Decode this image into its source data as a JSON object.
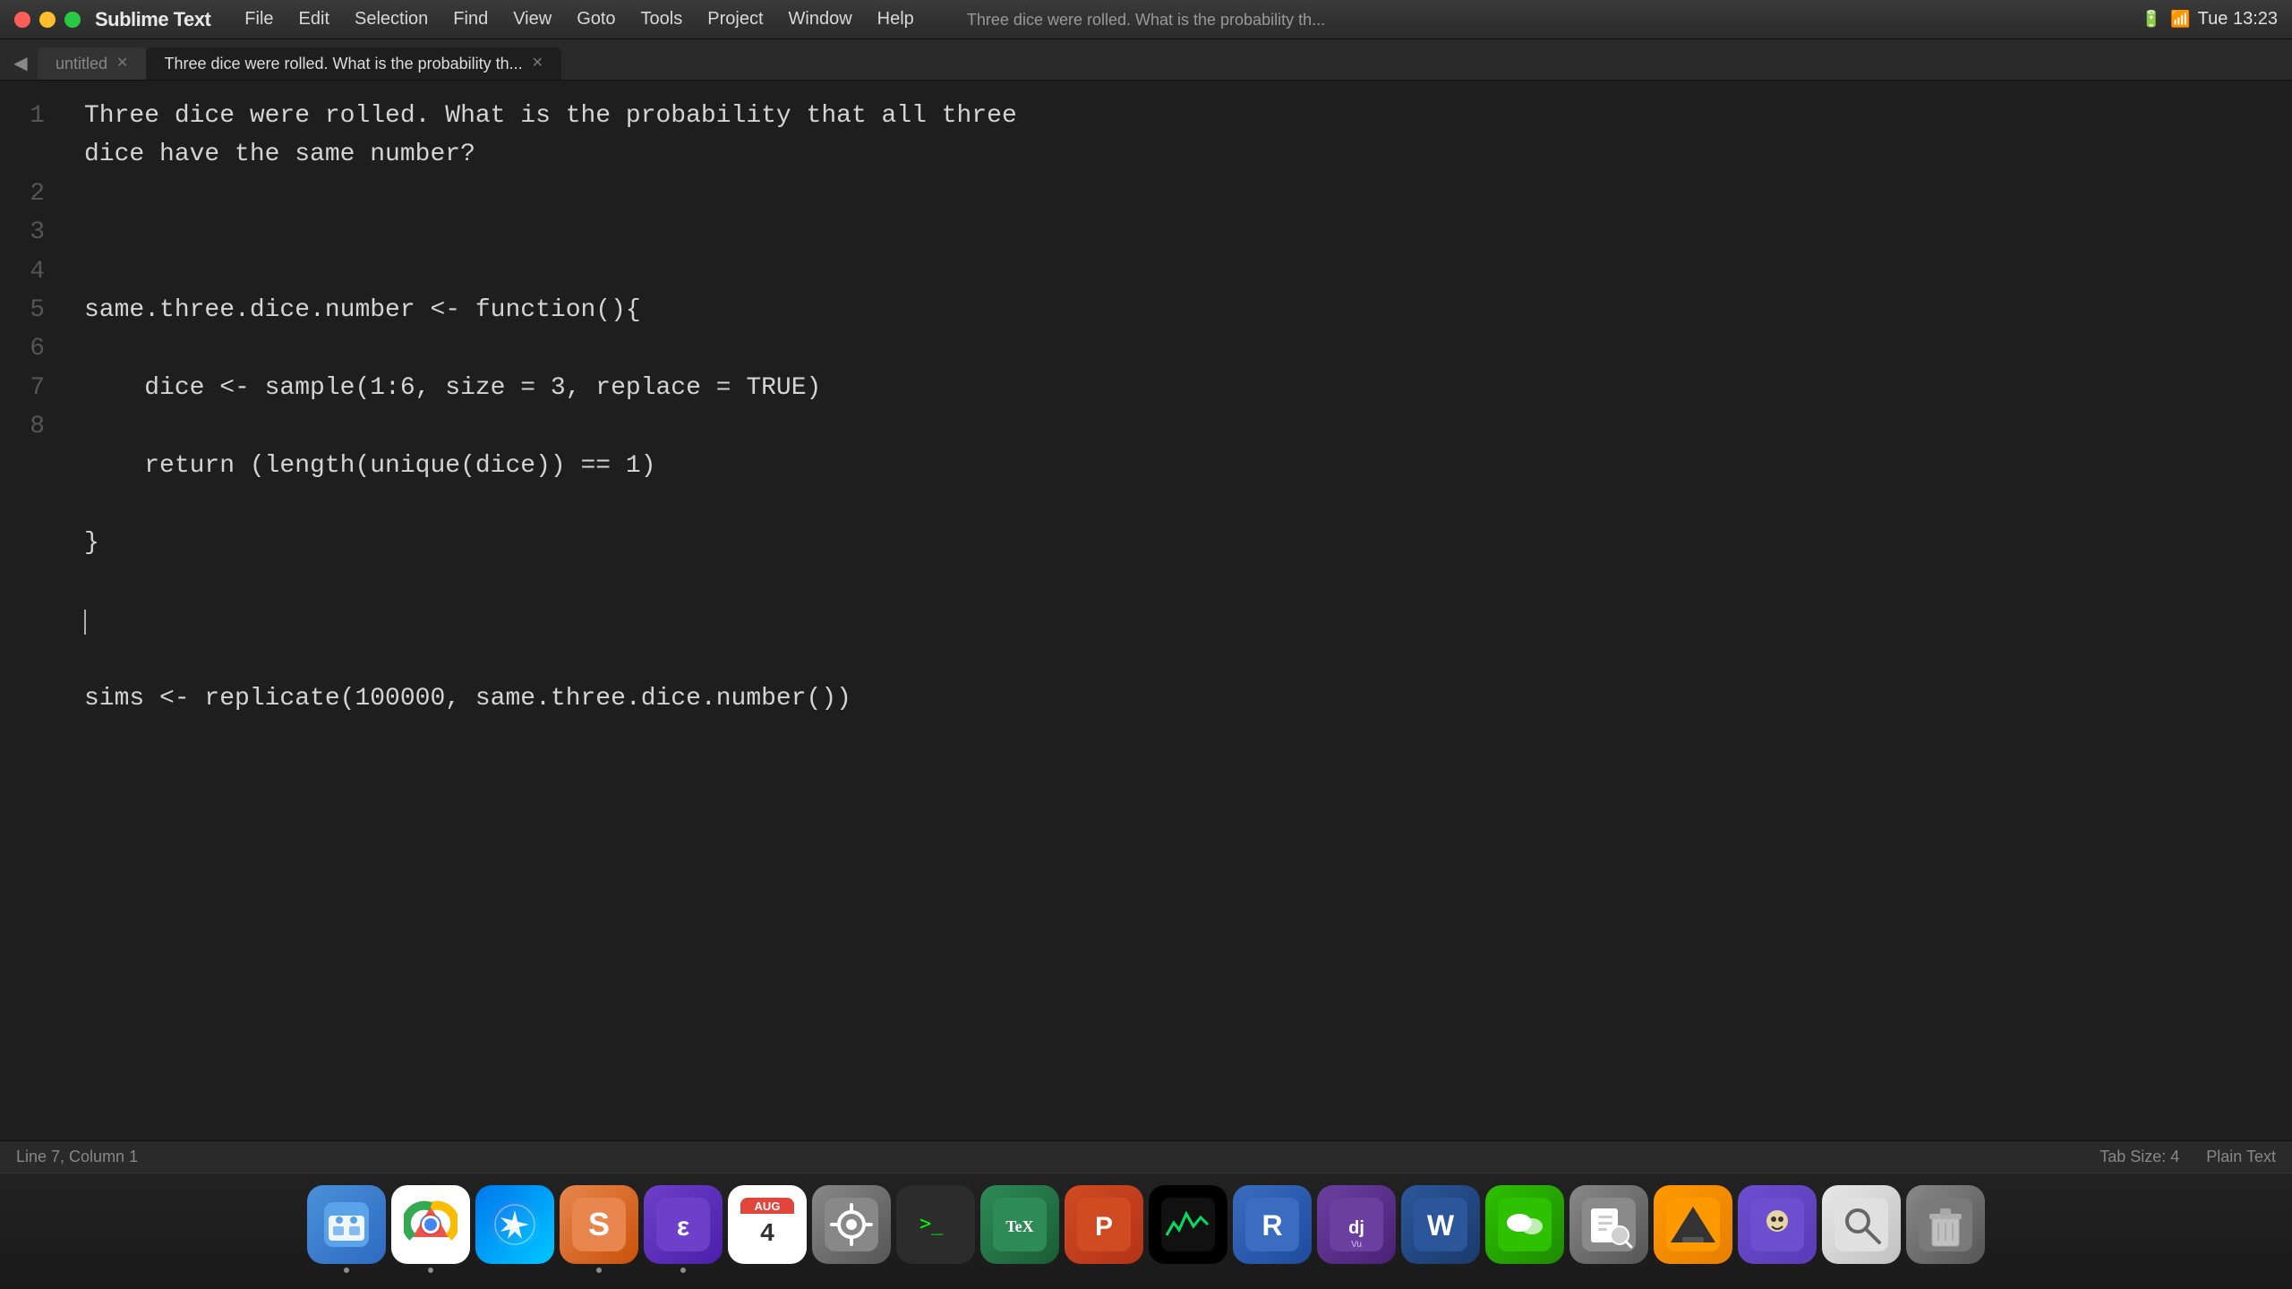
{
  "menubar": {
    "app_name": "Sublime Text",
    "items": [
      "File",
      "Edit",
      "Selection",
      "Find",
      "View",
      "Goto",
      "Tools",
      "Project",
      "Window",
      "Help"
    ],
    "clock": "Tue 13:23",
    "battery_icon": "🔋",
    "wifi_icon": "📶"
  },
  "tabbar": {
    "back_label": "◀",
    "tabs": [
      {
        "label": "untitled",
        "active": false
      },
      {
        "label": "Three dice were rolled. What is the probability th...",
        "active": true
      }
    ]
  },
  "title": "Three dice were rolled. What is the probability th...",
  "editor": {
    "lines": [
      {
        "number": "1",
        "code": "Three dice were rolled. What is the probability that all three"
      },
      {
        "number": "",
        "code": "dice have the same number?"
      },
      {
        "number": "2",
        "code": ""
      },
      {
        "number": "3",
        "code": "same.three.dice.number <- function(){"
      },
      {
        "number": "4",
        "code": "    dice <- sample(1:6, size = 3, replace = TRUE)"
      },
      {
        "number": "5",
        "code": "    return (length(unique(dice)) == 1)"
      },
      {
        "number": "6",
        "code": "}"
      },
      {
        "number": "7",
        "code": ""
      },
      {
        "number": "8",
        "code": "sims <- replicate(100000, same.three.dice.number())"
      }
    ]
  },
  "statusbar": {
    "position": "Line 7, Column 1",
    "tab_size": "Tab Size: 4",
    "file_type": "Plain Text"
  },
  "dock": {
    "items": [
      {
        "name": "Finder",
        "emoji": "🗂️",
        "colorClass": "finder-icon",
        "dot": true
      },
      {
        "name": "Chrome",
        "emoji": "🌐",
        "colorClass": "chrome-icon",
        "dot": true
      },
      {
        "name": "Safari",
        "emoji": "🧭",
        "colorClass": "safari-icon",
        "dot": false
      },
      {
        "name": "Sublime Text",
        "emoji": "✦",
        "colorClass": "sublime-icon",
        "dot": true
      },
      {
        "name": "Emacs",
        "emoji": "ε",
        "colorClass": "emacs-icon",
        "dot": true
      },
      {
        "name": "Calendar",
        "emoji": "📅",
        "colorClass": "calendar-icon",
        "dot": false
      },
      {
        "name": "System Preferences",
        "emoji": "⚙️",
        "colorClass": "system-icon",
        "dot": false
      },
      {
        "name": "Terminal",
        "emoji": ">_",
        "colorClass": "terminal-icon",
        "dot": false
      },
      {
        "name": "TeX",
        "emoji": "TeX",
        "colorClass": "tex-icon",
        "dot": false
      },
      {
        "name": "PowerPoint",
        "emoji": "P",
        "colorClass": "powerpoint-icon",
        "dot": false
      },
      {
        "name": "Activity Monitor",
        "emoji": "📊",
        "colorClass": "activity-icon",
        "dot": false
      },
      {
        "name": "R",
        "emoji": "R",
        "colorClass": "r-icon",
        "dot": false
      },
      {
        "name": "DjVu",
        "emoji": "dj",
        "colorClass": "djvu-icon",
        "dot": false
      },
      {
        "name": "Word",
        "emoji": "W",
        "colorClass": "word-icon",
        "dot": false
      },
      {
        "name": "WeChat",
        "emoji": "💬",
        "colorClass": "wechat-icon",
        "dot": false
      },
      {
        "name": "Preview",
        "emoji": "🖼️",
        "colorClass": "preview-icon",
        "dot": false
      },
      {
        "name": "VLC",
        "emoji": "🔶",
        "colorClass": "vlc-icon",
        "dot": false
      },
      {
        "name": "Alfred",
        "emoji": "🔍",
        "colorClass": "alfred-icon",
        "dot": false
      },
      {
        "name": "Finder2",
        "emoji": "🔎",
        "colorClass": "finder2-icon",
        "dot": false
      },
      {
        "name": "Trash",
        "emoji": "🗑️",
        "colorClass": "trash-icon",
        "dot": false
      }
    ]
  }
}
